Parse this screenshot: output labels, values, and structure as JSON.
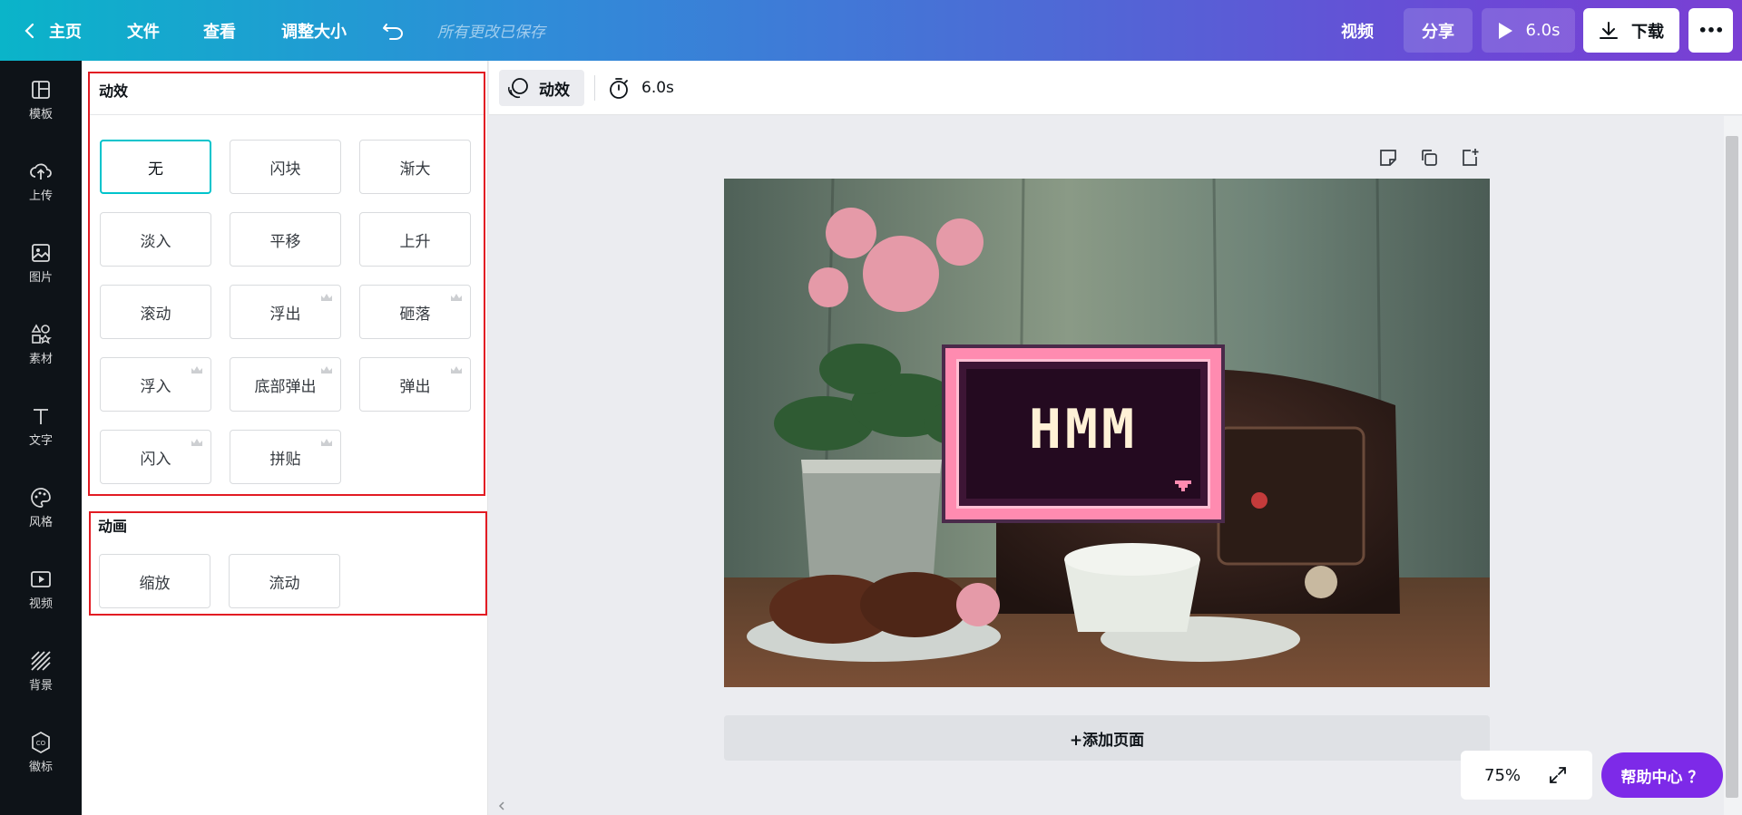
{
  "topbar": {
    "home_label": "主页",
    "file_label": "文件",
    "view_label": "查看",
    "resize_label": "调整大小",
    "saved_status": "所有更改已保存",
    "video_label": "视频",
    "share_label": "分享",
    "play_duration": "6.0s",
    "download_label": "下载",
    "more_label": "•••"
  },
  "rail": {
    "items": [
      {
        "label": "模板",
        "icon": "template-icon"
      },
      {
        "label": "上传",
        "icon": "upload-icon"
      },
      {
        "label": "图片",
        "icon": "image-icon"
      },
      {
        "label": "素材",
        "icon": "elements-icon"
      },
      {
        "label": "文字",
        "icon": "text-icon"
      },
      {
        "label": "风格",
        "icon": "palette-icon"
      },
      {
        "label": "视频",
        "icon": "video-icon"
      },
      {
        "label": "背景",
        "icon": "background-icon"
      },
      {
        "label": "徽标",
        "icon": "logo-icon"
      }
    ]
  },
  "panel": {
    "effects_title": "动效",
    "effects": [
      {
        "label": "无",
        "selected": true,
        "premium": false
      },
      {
        "label": "闪块",
        "selected": false,
        "premium": false
      },
      {
        "label": "渐大",
        "selected": false,
        "premium": false
      },
      {
        "label": "淡入",
        "selected": false,
        "premium": false
      },
      {
        "label": "平移",
        "selected": false,
        "premium": false
      },
      {
        "label": "上升",
        "selected": false,
        "premium": false
      },
      {
        "label": "滚动",
        "selected": false,
        "premium": false
      },
      {
        "label": "浮出",
        "selected": false,
        "premium": true
      },
      {
        "label": "砸落",
        "selected": false,
        "premium": true
      },
      {
        "label": "浮入",
        "selected": false,
        "premium": true
      },
      {
        "label": "底部弹出",
        "selected": false,
        "premium": true
      },
      {
        "label": "弹出",
        "selected": false,
        "premium": true
      },
      {
        "label": "闪入",
        "selected": false,
        "premium": true
      },
      {
        "label": "拼贴",
        "selected": false,
        "premium": true
      }
    ],
    "animation_title": "动画",
    "animations": [
      {
        "label": "缩放"
      },
      {
        "label": "流动"
      }
    ]
  },
  "context_toolbar": {
    "effects_label": "动效",
    "duration": "6.0s"
  },
  "canvas": {
    "sign_text": "HMM",
    "add_page_label": "+添加页面"
  },
  "zoom": {
    "value": "75%"
  },
  "help": {
    "label": "帮助中心 ？"
  },
  "colors": {
    "accent_teal": "#00c4cc",
    "highlight_red": "#e21b23",
    "help_purple": "#7d2ae8",
    "rail_bg": "#0e1318"
  }
}
